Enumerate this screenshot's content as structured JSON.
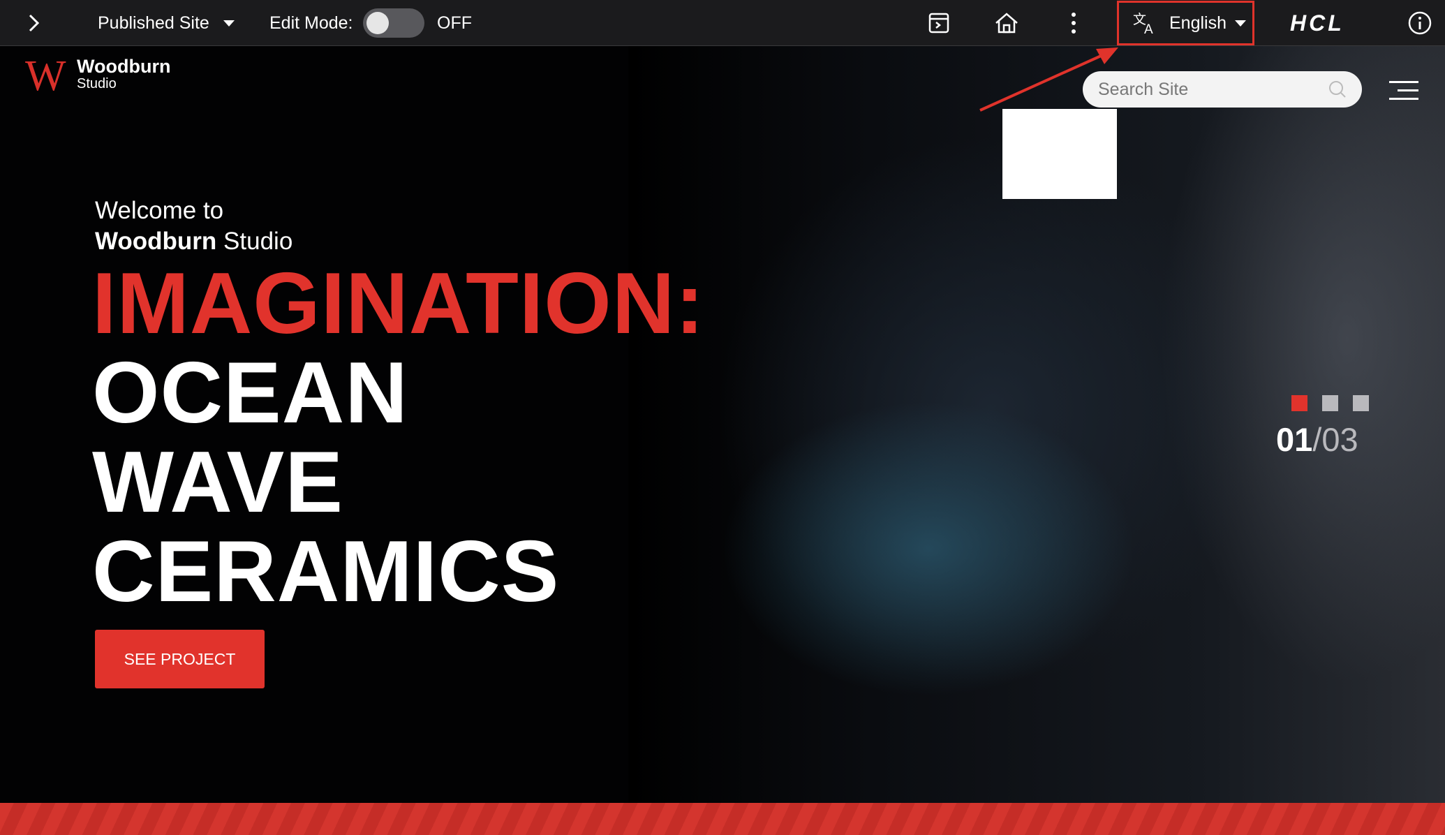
{
  "toolbar": {
    "site_label": "Published Site",
    "edit_mode_label": "Edit Mode:",
    "edit_mode_state": "OFF",
    "language": "English",
    "vendor_logo": "HCL",
    "icons": [
      "chevron-right-icon",
      "preview-icon",
      "home-icon",
      "more-vertical-icon",
      "translate-icon",
      "info-icon"
    ]
  },
  "header": {
    "logo_letter": "W",
    "brand_name": "Woodburn",
    "brand_sub": "Studio",
    "search_placeholder": "Search Site"
  },
  "hero": {
    "welcome_line1": "Welcome to",
    "welcome_brand": "Woodburn",
    "welcome_studio": "Studio",
    "headline_red": "IMAGINATION:",
    "headline_lines": [
      "OCEAN",
      "WAVE",
      "CERAMICS"
    ],
    "cta_label": "SEE PROJECT",
    "slide_current": "01",
    "slide_total": "/03"
  },
  "colors": {
    "accent": "#e1332c",
    "toolbar_bg": "#1b1b1d",
    "dot_active": "#e1332c",
    "dot_inactive": "#b9b9bd"
  }
}
